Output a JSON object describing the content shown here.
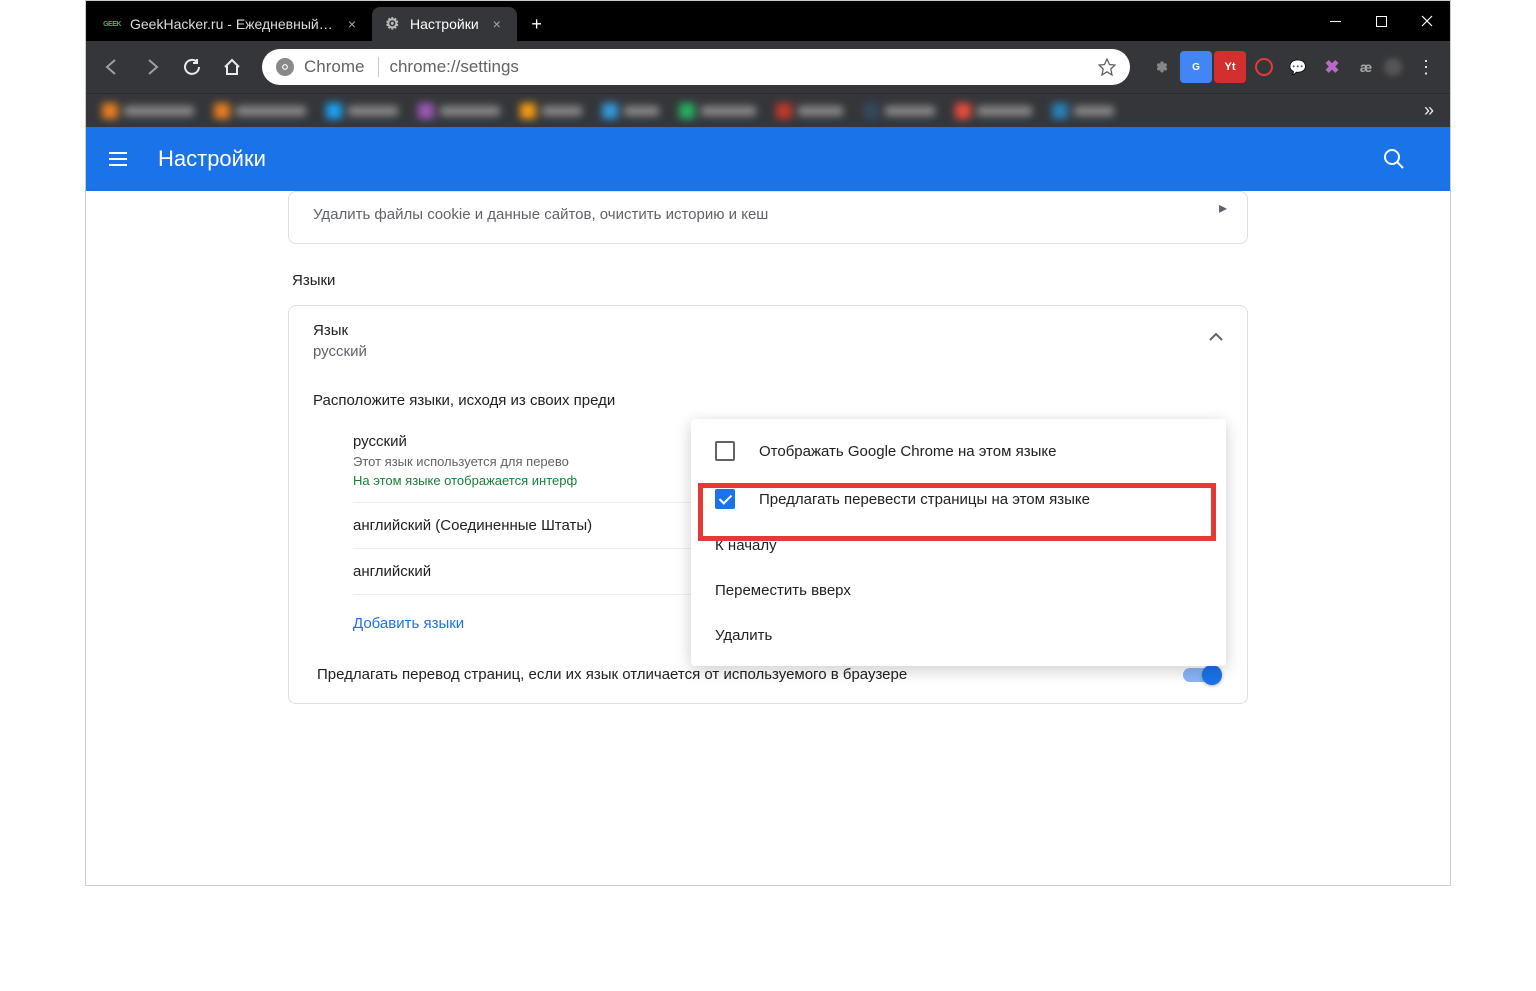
{
  "window": {
    "tabs": [
      {
        "favicon_text": "GEEK",
        "title": "GeekHacker.ru - Ежедневный жу"
      },
      {
        "favicon_text": "⚙",
        "title": "Настройки"
      }
    ]
  },
  "omnibox": {
    "chip": "Chrome",
    "url": "chrome://settings"
  },
  "settings": {
    "header_title": "Настройки",
    "clear_history": {
      "subtitle": "Удалить файлы cookie и данные сайтов, очистить историю и кеш"
    },
    "languages_section": "Языки",
    "language_header": {
      "label": "Язык",
      "value": "русский"
    },
    "order_instruction": "Расположите языки, исходя из своих преди",
    "langs": [
      {
        "name": "русский",
        "note1": "Этот язык используется для перево",
        "note2": "На этом языке отображается интерф"
      },
      {
        "name": "английский (Соединенные Штаты)",
        "note1": "",
        "note2": ""
      },
      {
        "name": "английский",
        "note1": "",
        "note2": ""
      }
    ],
    "add_languages": "Добавить языки",
    "offer_translate": "Предлагать перевод страниц, если их язык отличается от используемого в браузере"
  },
  "popup": {
    "display_chrome": "Отображать Google Chrome на этом языке",
    "offer_translate_lang": "Предлагать перевести страницы на этом языке",
    "to_top": "К началу",
    "move_up": "Переместить вверх",
    "delete": "Удалить"
  }
}
